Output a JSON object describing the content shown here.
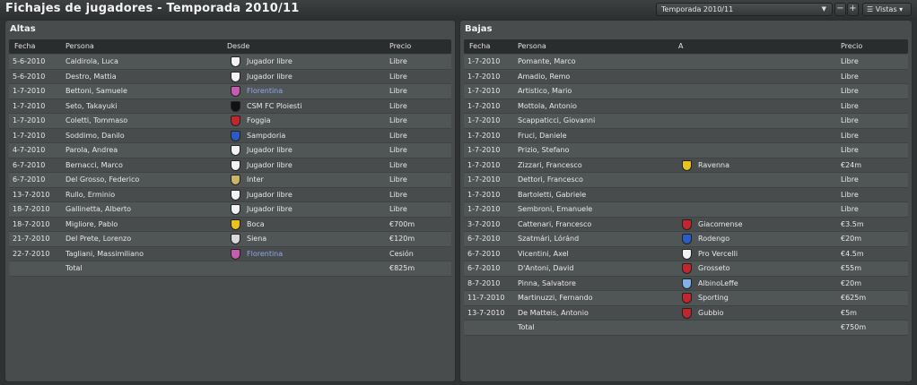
{
  "page_title": "Fichajes de jugadores - Temporada 2010/11",
  "toolbar": {
    "season_select": "Temporada 2010/11",
    "minus_label": "−",
    "plus_label": "+",
    "views_label": "☰ Vistas ▾"
  },
  "left": {
    "title": "Altas",
    "headers": {
      "fecha": "Fecha",
      "persona": "Persona",
      "club": "Desde",
      "precio": "Precio"
    },
    "rows": [
      {
        "fecha": "5-6-2010",
        "persona": "Caldirola, Luca",
        "club": "Jugador libre",
        "precio": "Libre",
        "crest": "#f2f2f2",
        "link": false
      },
      {
        "fecha": "5-6-2010",
        "persona": "Destro, Mattia",
        "club": "Jugador libre",
        "precio": "Libre",
        "crest": "#f2f2f2",
        "link": false
      },
      {
        "fecha": "1-7-2010",
        "persona": "Bettoni, Samuele",
        "club": "Florentina",
        "precio": "Libre",
        "crest": "#c85ab0",
        "link": true
      },
      {
        "fecha": "1-7-2010",
        "persona": "Seto, Takayuki",
        "club": "CSM FC Ploiesti",
        "precio": "Libre",
        "crest": "#111111",
        "link": false
      },
      {
        "fecha": "1-7-2010",
        "persona": "Coletti, Tommaso",
        "club": "Foggia",
        "precio": "Libre",
        "crest": "#c0262b",
        "link": false
      },
      {
        "fecha": "1-7-2010",
        "persona": "Soddimo, Danilo",
        "club": "Sampdoria",
        "precio": "Libre",
        "crest": "#2a5cc4",
        "link": false
      },
      {
        "fecha": "4-7-2010",
        "persona": "Parola, Andrea",
        "club": "Jugador libre",
        "precio": "Libre",
        "crest": "#f2f2f2",
        "link": false
      },
      {
        "fecha": "6-7-2010",
        "persona": "Bernacci, Marco",
        "club": "Jugador libre",
        "precio": "Libre",
        "crest": "#f2f2f2",
        "link": false
      },
      {
        "fecha": "6-7-2010",
        "persona": "Del Grosso, Federico",
        "club": "Inter",
        "precio": "Libre",
        "crest": "#c9b46a",
        "link": false
      },
      {
        "fecha": "13-7-2010",
        "persona": "Rullo, Erminio",
        "club": "Jugador libre",
        "precio": "Libre",
        "crest": "#f2f2f2",
        "link": false
      },
      {
        "fecha": "18-7-2010",
        "persona": "Gallinetta, Alberto",
        "club": "Jugador libre",
        "precio": "Libre",
        "crest": "#f2f2f2",
        "link": false
      },
      {
        "fecha": "18-7-2010",
        "persona": "Migliore, Pablo",
        "club": "Boca",
        "precio": "€700m",
        "crest": "#e8c21e",
        "link": false
      },
      {
        "fecha": "21-7-2010",
        "persona": "Del Prete, Lorenzo",
        "club": "Siena",
        "precio": "€120m",
        "crest": "#d8d8d8",
        "link": false
      },
      {
        "fecha": "22-7-2010",
        "persona": "Tagliani, Massimiliano",
        "club": "Florentina",
        "precio": "Cesión",
        "crest": "#c85ab0",
        "link": true
      },
      {
        "fecha": "",
        "persona": "Total",
        "club": "",
        "precio": "€825m",
        "crest": "",
        "link": false
      }
    ]
  },
  "right": {
    "title": "Bajas",
    "headers": {
      "fecha": "Fecha",
      "persona": "Persona",
      "club": "A",
      "precio": "Precio"
    },
    "rows": [
      {
        "fecha": "1-7-2010",
        "persona": "Pomante, Marco",
        "club": "",
        "precio": "Libre",
        "crest": "",
        "link": false
      },
      {
        "fecha": "1-7-2010",
        "persona": "Amadio, Remo",
        "club": "",
        "precio": "Libre",
        "crest": "",
        "link": false
      },
      {
        "fecha": "1-7-2010",
        "persona": "Artistico, Mario",
        "club": "",
        "precio": "Libre",
        "crest": "",
        "link": false
      },
      {
        "fecha": "1-7-2010",
        "persona": "Mottola, Antonio",
        "club": "",
        "precio": "Libre",
        "crest": "",
        "link": false
      },
      {
        "fecha": "1-7-2010",
        "persona": "Scappaticci, Giovanni",
        "club": "",
        "precio": "Libre",
        "crest": "",
        "link": false
      },
      {
        "fecha": "1-7-2010",
        "persona": "Fruci, Daniele",
        "club": "",
        "precio": "Libre",
        "crest": "",
        "link": false
      },
      {
        "fecha": "1-7-2010",
        "persona": "Prizio, Stefano",
        "club": "",
        "precio": "Libre",
        "crest": "",
        "link": false
      },
      {
        "fecha": "1-7-2010",
        "persona": "Zizzari, Francesco",
        "club": "Ravenna",
        "precio": "€24m",
        "crest": "#e8c21e",
        "link": false
      },
      {
        "fecha": "1-7-2010",
        "persona": "Dettori, Francesco",
        "club": "",
        "precio": "Libre",
        "crest": "",
        "link": false
      },
      {
        "fecha": "1-7-2010",
        "persona": "Bartoletti, Gabriele",
        "club": "",
        "precio": "Libre",
        "crest": "",
        "link": false
      },
      {
        "fecha": "1-7-2010",
        "persona": "Sembroni, Emanuele",
        "club": "",
        "precio": "Libre",
        "crest": "",
        "link": false
      },
      {
        "fecha": "3-7-2010",
        "persona": "Cattenari, Francesco",
        "club": "Giacomense",
        "precio": "€3.5m",
        "crest": "#c0262b",
        "link": false
      },
      {
        "fecha": "6-7-2010",
        "persona": "Szatmári, Lóránd",
        "club": "Rodengo",
        "precio": "€20m",
        "crest": "#2a5cc4",
        "link": false
      },
      {
        "fecha": "6-7-2010",
        "persona": "Vicentini, Axel",
        "club": "Pro Vercelli",
        "precio": "€4.5m",
        "crest": "#f2f2f2",
        "link": false
      },
      {
        "fecha": "6-7-2010",
        "persona": "D'Antoni, David",
        "club": "Grosseto",
        "precio": "€55m",
        "crest": "#c0262b",
        "link": false
      },
      {
        "fecha": "8-7-2010",
        "persona": "Pinna, Salvatore",
        "club": "AlbinoLeffe",
        "precio": "€20m",
        "crest": "#7fb0e8",
        "link": false
      },
      {
        "fecha": "11-7-2010",
        "persona": "Martinuzzi, Fernando",
        "club": "Sporting",
        "precio": "€625m",
        "crest": "#c0262b",
        "link": false
      },
      {
        "fecha": "13-7-2010",
        "persona": "De Matteis, Antonio",
        "club": "Gubbio",
        "precio": "€5m",
        "crest": "#c0262b",
        "link": false
      },
      {
        "fecha": "",
        "persona": "Total",
        "club": "",
        "precio": "€750m",
        "crest": "",
        "link": false
      }
    ]
  }
}
